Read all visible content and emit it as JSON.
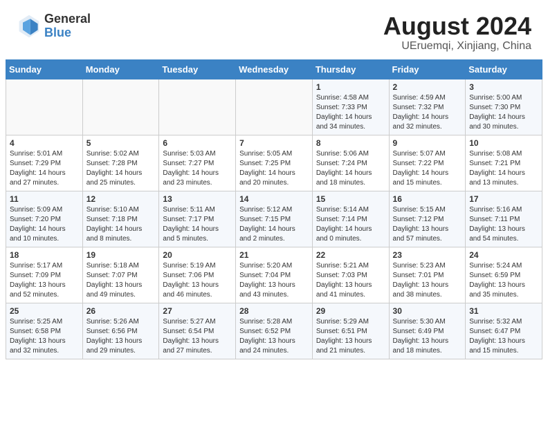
{
  "header": {
    "logo_general": "General",
    "logo_blue": "Blue",
    "title": "August 2024",
    "subtitle": "UEruemqi, Xinjiang, China"
  },
  "weekdays": [
    "Sunday",
    "Monday",
    "Tuesday",
    "Wednesday",
    "Thursday",
    "Friday",
    "Saturday"
  ],
  "weeks": [
    [
      {
        "day": "",
        "info": ""
      },
      {
        "day": "",
        "info": ""
      },
      {
        "day": "",
        "info": ""
      },
      {
        "day": "",
        "info": ""
      },
      {
        "day": "1",
        "info": "Sunrise: 4:58 AM\nSunset: 7:33 PM\nDaylight: 14 hours and 34 minutes."
      },
      {
        "day": "2",
        "info": "Sunrise: 4:59 AM\nSunset: 7:32 PM\nDaylight: 14 hours and 32 minutes."
      },
      {
        "day": "3",
        "info": "Sunrise: 5:00 AM\nSunset: 7:30 PM\nDaylight: 14 hours and 30 minutes."
      }
    ],
    [
      {
        "day": "4",
        "info": "Sunrise: 5:01 AM\nSunset: 7:29 PM\nDaylight: 14 hours and 27 minutes."
      },
      {
        "day": "5",
        "info": "Sunrise: 5:02 AM\nSunset: 7:28 PM\nDaylight: 14 hours and 25 minutes."
      },
      {
        "day": "6",
        "info": "Sunrise: 5:03 AM\nSunset: 7:27 PM\nDaylight: 14 hours and 23 minutes."
      },
      {
        "day": "7",
        "info": "Sunrise: 5:05 AM\nSunset: 7:25 PM\nDaylight: 14 hours and 20 minutes."
      },
      {
        "day": "8",
        "info": "Sunrise: 5:06 AM\nSunset: 7:24 PM\nDaylight: 14 hours and 18 minutes."
      },
      {
        "day": "9",
        "info": "Sunrise: 5:07 AM\nSunset: 7:22 PM\nDaylight: 14 hours and 15 minutes."
      },
      {
        "day": "10",
        "info": "Sunrise: 5:08 AM\nSunset: 7:21 PM\nDaylight: 14 hours and 13 minutes."
      }
    ],
    [
      {
        "day": "11",
        "info": "Sunrise: 5:09 AM\nSunset: 7:20 PM\nDaylight: 14 hours and 10 minutes."
      },
      {
        "day": "12",
        "info": "Sunrise: 5:10 AM\nSunset: 7:18 PM\nDaylight: 14 hours and 8 minutes."
      },
      {
        "day": "13",
        "info": "Sunrise: 5:11 AM\nSunset: 7:17 PM\nDaylight: 14 hours and 5 minutes."
      },
      {
        "day": "14",
        "info": "Sunrise: 5:12 AM\nSunset: 7:15 PM\nDaylight: 14 hours and 2 minutes."
      },
      {
        "day": "15",
        "info": "Sunrise: 5:14 AM\nSunset: 7:14 PM\nDaylight: 14 hours and 0 minutes."
      },
      {
        "day": "16",
        "info": "Sunrise: 5:15 AM\nSunset: 7:12 PM\nDaylight: 13 hours and 57 minutes."
      },
      {
        "day": "17",
        "info": "Sunrise: 5:16 AM\nSunset: 7:11 PM\nDaylight: 13 hours and 54 minutes."
      }
    ],
    [
      {
        "day": "18",
        "info": "Sunrise: 5:17 AM\nSunset: 7:09 PM\nDaylight: 13 hours and 52 minutes."
      },
      {
        "day": "19",
        "info": "Sunrise: 5:18 AM\nSunset: 7:07 PM\nDaylight: 13 hours and 49 minutes."
      },
      {
        "day": "20",
        "info": "Sunrise: 5:19 AM\nSunset: 7:06 PM\nDaylight: 13 hours and 46 minutes."
      },
      {
        "day": "21",
        "info": "Sunrise: 5:20 AM\nSunset: 7:04 PM\nDaylight: 13 hours and 43 minutes."
      },
      {
        "day": "22",
        "info": "Sunrise: 5:21 AM\nSunset: 7:03 PM\nDaylight: 13 hours and 41 minutes."
      },
      {
        "day": "23",
        "info": "Sunrise: 5:23 AM\nSunset: 7:01 PM\nDaylight: 13 hours and 38 minutes."
      },
      {
        "day": "24",
        "info": "Sunrise: 5:24 AM\nSunset: 6:59 PM\nDaylight: 13 hours and 35 minutes."
      }
    ],
    [
      {
        "day": "25",
        "info": "Sunrise: 5:25 AM\nSunset: 6:58 PM\nDaylight: 13 hours and 32 minutes."
      },
      {
        "day": "26",
        "info": "Sunrise: 5:26 AM\nSunset: 6:56 PM\nDaylight: 13 hours and 29 minutes."
      },
      {
        "day": "27",
        "info": "Sunrise: 5:27 AM\nSunset: 6:54 PM\nDaylight: 13 hours and 27 minutes."
      },
      {
        "day": "28",
        "info": "Sunrise: 5:28 AM\nSunset: 6:52 PM\nDaylight: 13 hours and 24 minutes."
      },
      {
        "day": "29",
        "info": "Sunrise: 5:29 AM\nSunset: 6:51 PM\nDaylight: 13 hours and 21 minutes."
      },
      {
        "day": "30",
        "info": "Sunrise: 5:30 AM\nSunset: 6:49 PM\nDaylight: 13 hours and 18 minutes."
      },
      {
        "day": "31",
        "info": "Sunrise: 5:32 AM\nSunset: 6:47 PM\nDaylight: 13 hours and 15 minutes."
      }
    ]
  ]
}
